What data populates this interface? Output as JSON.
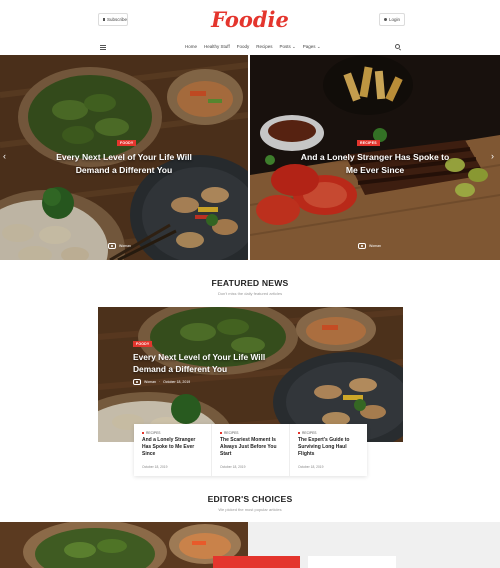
{
  "header": {
    "subscribe_label": "Subscribe",
    "logo_text": "Foodie",
    "login_label": "Login"
  },
  "nav": {
    "items": [
      "Home",
      "Healthy Stuff",
      "Foody",
      "Recipes",
      "Posts",
      "Pages"
    ]
  },
  "hero": {
    "slides": [
      {
        "badge": "FOODY",
        "title_line1": "Every Next Level of Your Life Will",
        "title_line2": "Demand a Different You",
        "author": "Woman"
      },
      {
        "badge": "RECIPES",
        "title_line1": "And a Lonely Stranger Has Spoke to",
        "title_line2": "Me Ever Since",
        "author": "Woman"
      }
    ]
  },
  "featured": {
    "title": "FEATURED NEWS",
    "subtitle": "Don't miss the daily featured articles",
    "main": {
      "badge": "FOODY",
      "title_line1": "Every Next Level of Your Life Will",
      "title_line2": "Demand a Different You",
      "author": "Woman",
      "date": "October 18, 2019"
    },
    "cards": [
      {
        "category": "RECIPES",
        "title": "And a Lonely Stranger Has Spoke to Me Ever Since",
        "date": "October 18, 2019"
      },
      {
        "category": "RECIPES",
        "title": "The Scariest Moment Is Always Just Before You Start",
        "date": "October 18, 2019"
      },
      {
        "category": "RECIPES",
        "title": "The Expert's Guide to Surviving Long Haul Flights",
        "date": "October 18, 2019"
      }
    ]
  },
  "editors": {
    "title": "EDITOR'S CHOICES",
    "subtitle": "We picked the most popular articles"
  },
  "colors": {
    "accent": "#e4352d"
  }
}
